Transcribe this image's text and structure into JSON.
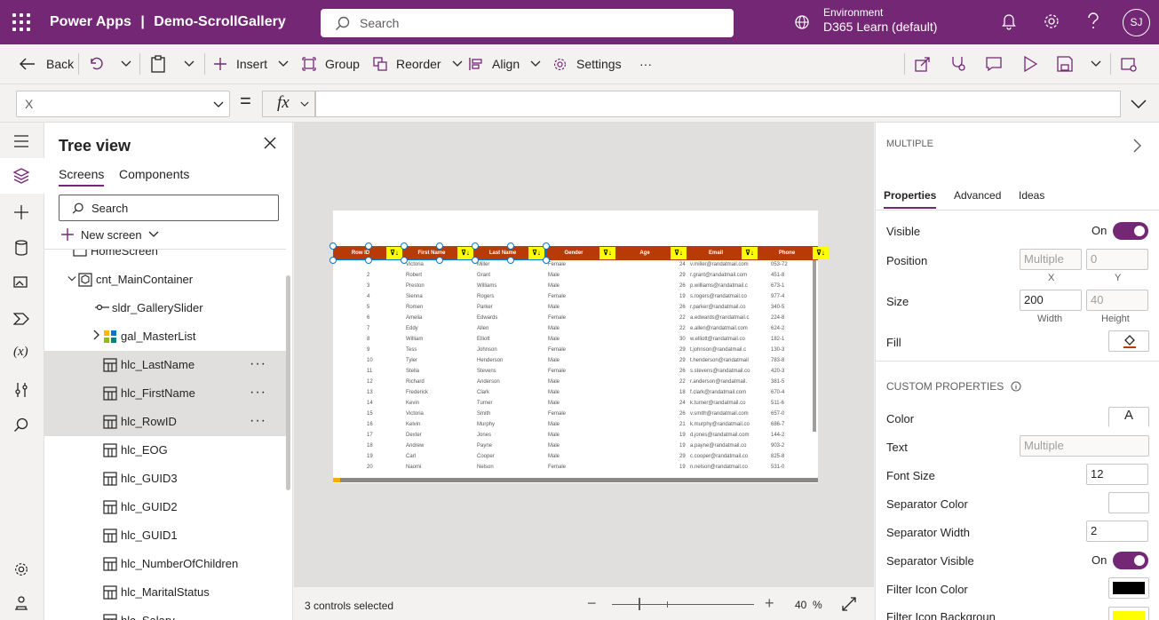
{
  "topbar": {
    "app_name": "Power Apps",
    "divider": "|",
    "app_title": "Demo-ScrollGallery",
    "search_placeholder": "Search",
    "environment_label": "Environment",
    "environment_value": "D365 Learn (default)",
    "avatar_initials": "SJ",
    "bg_color": "#742774"
  },
  "cmdbar": {
    "back": "Back",
    "insert": "Insert",
    "group": "Group",
    "reorder": "Reorder",
    "align": "Align",
    "settings": "Settings",
    "more": "···"
  },
  "formula": {
    "property": "X",
    "equals": "=",
    "fx": "fx",
    "value": ""
  },
  "tree": {
    "title": "Tree view",
    "tabs": [
      "Screens",
      "Components"
    ],
    "search_placeholder": "Search",
    "new_screen": "New screen",
    "nodes": [
      {
        "label": "HomeScreen",
        "icon": "screen-icon",
        "selected": false
      },
      {
        "label": "cnt_MainContainer",
        "icon": "container-icon",
        "selected": false
      },
      {
        "label": "sldr_GallerySlider",
        "icon": "slider-icon",
        "selected": false
      },
      {
        "label": "gal_MasterList",
        "icon": "gallery-icon",
        "selected": false
      },
      {
        "label": "hlc_LastName",
        "icon": "horizontal-container-icon",
        "selected": true
      },
      {
        "label": "hlc_FirstName",
        "icon": "horizontal-container-icon",
        "selected": true
      },
      {
        "label": "hlc_RowID",
        "icon": "horizontal-container-icon",
        "selected": true
      },
      {
        "label": "hlc_EOG",
        "icon": "horizontal-container-icon",
        "selected": false
      },
      {
        "label": "hlc_GUID3",
        "icon": "horizontal-container-icon",
        "selected": false
      },
      {
        "label": "hlc_GUID2",
        "icon": "horizontal-container-icon",
        "selected": false
      },
      {
        "label": "hlc_GUID1",
        "icon": "horizontal-container-icon",
        "selected": false
      },
      {
        "label": "hlc_NumberOfChildren",
        "icon": "horizontal-container-icon",
        "selected": false
      },
      {
        "label": "hlc_MaritalStatus",
        "icon": "horizontal-container-icon",
        "selected": false
      },
      {
        "label": "hlc_Salary",
        "icon": "horizontal-container-icon",
        "selected": false
      }
    ],
    "more_label": "···"
  },
  "gallery": {
    "header_color": "#b83b07",
    "headers": [
      "Row ID",
      "First Name",
      "Last Name",
      "Gender",
      "Age",
      "Email",
      "Phone"
    ],
    "filter_glyph": "⊽↓↑",
    "rows": [
      [
        "",
        "Victoria",
        "Miller",
        "Female",
        "24",
        "v.miller@randatmail.com",
        "053-72"
      ],
      [
        "2",
        "Robert",
        "Grant",
        "Male",
        "29",
        "r.grant@randatmail.com",
        "451-8"
      ],
      [
        "3",
        "Preston",
        "Williams",
        "Male",
        "26",
        "p.williams@randatmail.c",
        "673-1"
      ],
      [
        "4",
        "Sienna",
        "Rogers",
        "Female",
        "19",
        "s.rogers@randatmail.co",
        "977-4"
      ],
      [
        "5",
        "Romen",
        "Parker",
        "Male",
        "26",
        "r.parker@randatmail.co",
        "340-5"
      ],
      [
        "6",
        "Amelia",
        "Edwards",
        "Female",
        "22",
        "a.edwards@randatmail.c",
        "224-8"
      ],
      [
        "7",
        "Eddy",
        "Allen",
        "Male",
        "22",
        "e.allen@randatmail.com",
        "624-2"
      ],
      [
        "8",
        "William",
        "Elliott",
        "Male",
        "30",
        "w.elliott@randatmail.co",
        "182-1"
      ],
      [
        "9",
        "Tess",
        "Johnson",
        "Female",
        "29",
        "t.johnson@randatmail.c",
        "130-3"
      ],
      [
        "10",
        "Tyler",
        "Henderson",
        "Male",
        "29",
        "t.henderson@randatmail",
        "783-8"
      ],
      [
        "11",
        "Stella",
        "Stevens",
        "Female",
        "26",
        "s.stevens@randatmail.co",
        "420-3"
      ],
      [
        "12",
        "Richard",
        "Anderson",
        "Male",
        "22",
        "r.anderson@randatmail.",
        "381-5"
      ],
      [
        "13",
        "Frederick",
        "Clark",
        "Male",
        "18",
        "f.clark@randatmail.com",
        "670-4"
      ],
      [
        "14",
        "Kevin",
        "Turner",
        "Male",
        "24",
        "k.turner@randatmail.co",
        "511-6"
      ],
      [
        "15",
        "Victoria",
        "Smith",
        "Female",
        "26",
        "v.smith@randatmail.com",
        "657-0"
      ],
      [
        "16",
        "Kelvin",
        "Murphy",
        "Male",
        "21",
        "k.murphy@randatmail.co",
        "686-7"
      ],
      [
        "17",
        "Dexter",
        "Jones",
        "Male",
        "19",
        "d.jones@randatmail.com",
        "144-2"
      ],
      [
        "18",
        "Andrew",
        "Payne",
        "Male",
        "19",
        "a.payne@randatmail.co",
        "903-2"
      ],
      [
        "19",
        "Carl",
        "Cooper",
        "Male",
        "29",
        "c.cooper@randatmail.co",
        "825-8"
      ],
      [
        "20",
        "Naomi",
        "Nelson",
        "Female",
        "19",
        "n.nelson@randatmail.co",
        "531-0"
      ]
    ]
  },
  "status": {
    "selected": "3 controls selected",
    "zoom_value": "40",
    "zoom_unit": "%",
    "minus": "—",
    "plus": "+"
  },
  "props": {
    "type": "MULTIPLE",
    "tabs": [
      "Properties",
      "Advanced",
      "Ideas"
    ],
    "visible_label": "Visible",
    "visible_state": "On",
    "position_label": "Position",
    "position_x": "Multiple",
    "position_y": "0",
    "x_label": "X",
    "y_label": "Y",
    "size_label": "Size",
    "width": "200",
    "height": "40",
    "width_label": "Width",
    "height_label": "Height",
    "fill_label": "Fill",
    "custom_header": "CUSTOM PROPERTIES",
    "color_label": "Color",
    "color_glyph": "A",
    "text_label": "Text",
    "text_value": "Multiple",
    "font_size_label": "Font Size",
    "font_size_value": "12",
    "sep_color_label": "Separator Color",
    "sep_width_label": "Separator Width",
    "sep_width_value": "2",
    "sep_visible_label": "Separator Visible",
    "sep_visible_state": "On",
    "filter_icon_color_label": "Filter Icon Color",
    "filter_icon_color": "#000000",
    "filter_icon_bg_label": "Filter Icon Backgroun",
    "filter_icon_bg": "#ffff00",
    "accent": "#742774"
  }
}
